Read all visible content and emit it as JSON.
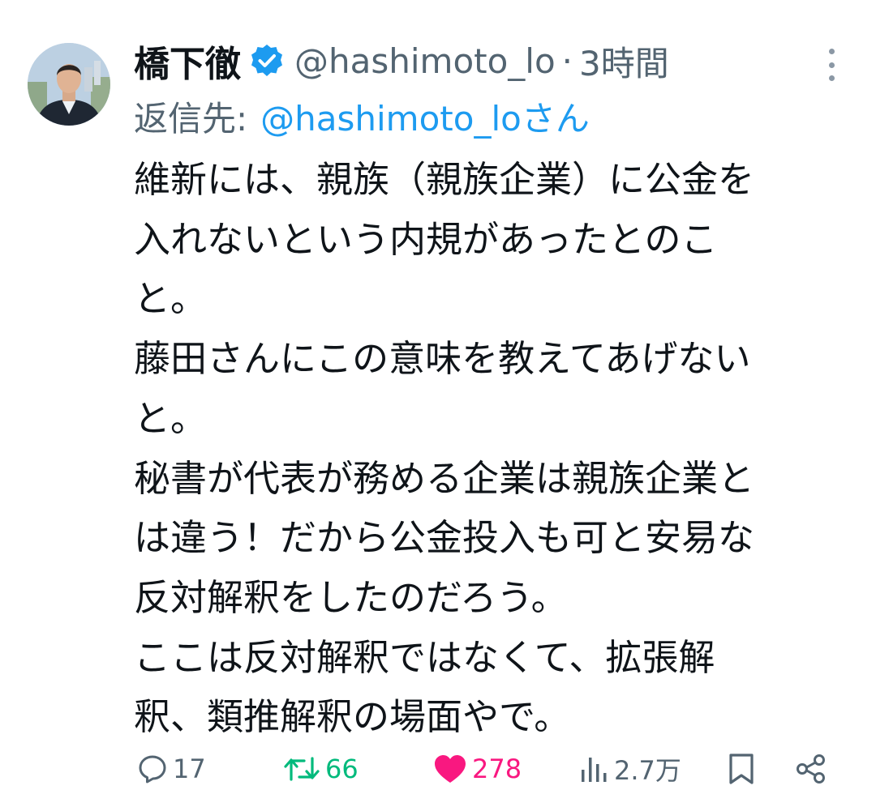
{
  "tweet": {
    "author_name": "橋下徹",
    "handle": "@hashimoto_lo",
    "separator": "·",
    "time": "3時間",
    "reply_prefix": "返信先:",
    "reply_to": "@hashimoto_loさん",
    "body_lines": [
      "維新には、親族（親族企業）に公金を",
      "入れないという内規があったとのこ",
      "と。",
      "藤田さんにこの意味を教えてあげない",
      "と。",
      "秘書が代表が務める企業は親族企業と",
      "は違う！だから公金投入も可と安易な",
      "反対解釈をしたのだろう。",
      "ここは反対解釈ではなくて、拡張解",
      "釈、類推解釈の場面やで。"
    ]
  },
  "actions": {
    "replies": "17",
    "retweets": "66",
    "likes": "278",
    "views": "2.7万"
  },
  "icons": {
    "verified": "verified-badge-icon",
    "more": "more-vertical-icon",
    "reply": "reply-icon",
    "retweet": "retweet-icon",
    "like": "heart-icon",
    "views": "views-icon",
    "bookmark": "bookmark-icon",
    "share": "share-icon"
  },
  "colors": {
    "verified": "#1d9bf0",
    "link": "#1d9bf0",
    "secondary_text": "#536471",
    "retweeted": "#00ba7c",
    "liked": "#f91880"
  }
}
